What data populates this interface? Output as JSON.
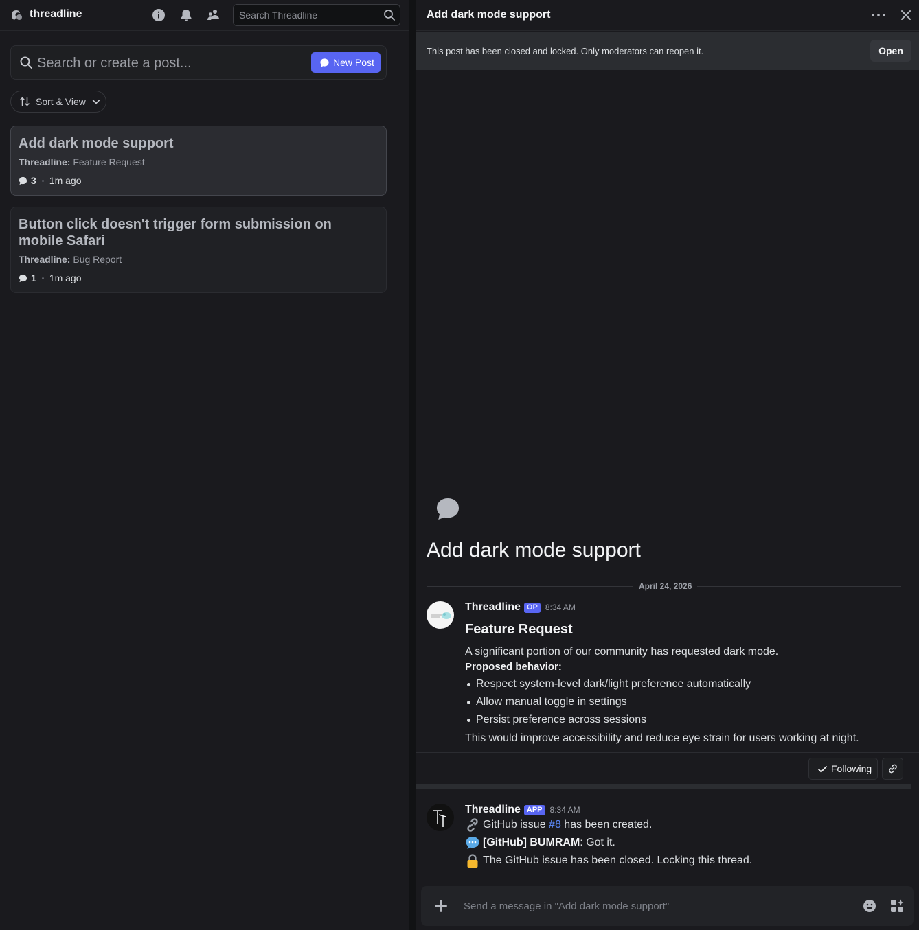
{
  "app": {
    "name": "threadline",
    "search_placeholder": "Search Threadline"
  },
  "forum": {
    "search_placeholder": "Search or create a post...",
    "new_post_label": "New Post",
    "sort_label": "Sort & View",
    "posts": [
      {
        "title": "Add dark mode support",
        "channel": "Threadline",
        "tag": "Feature Request",
        "replies": "3",
        "age": "1m ago"
      },
      {
        "title": "Button click doesn't trigger form submission on mobile Safari",
        "channel": "Threadline",
        "tag": "Bug Report",
        "replies": "1",
        "age": "1m ago"
      }
    ]
  },
  "thread": {
    "title": "Add dark mode support",
    "locked_notice": "This post has been closed and locked. Only moderators can reopen it.",
    "open_label": "Open",
    "big_title": "Add dark mode support",
    "date": "April 24, 2026",
    "message1": {
      "author": "Threadline",
      "badge": "OP",
      "time": "8:34 AM",
      "heading": "Feature Request",
      "intro": "A significant portion of our community has requested dark mode.",
      "proposed_label": "Proposed behavior:",
      "items": [
        "Respect system-level dark/light preference automatically",
        "Allow manual toggle in settings",
        "Persist preference across sessions"
      ],
      "outro": "This would improve accessibility and reduce eye strain for users working at night."
    },
    "following_label": "Following",
    "message2": {
      "author": "Threadline",
      "badge": "APP",
      "time": "8:34 AM",
      "line1_pre": "GitHub issue ",
      "line1_link": "#8",
      "line1_post": " has been created.",
      "line2_bold": "[GitHub] BUMRAM",
      "line2_text": ": Got it.",
      "line3": "The GitHub issue has been closed. Locking this thread."
    },
    "composer_placeholder": "Send a message in \"Add dark mode support\""
  },
  "colors": {
    "accent": "#5865f2",
    "link": "#5d8cff",
    "background": "#1a1a1e"
  }
}
